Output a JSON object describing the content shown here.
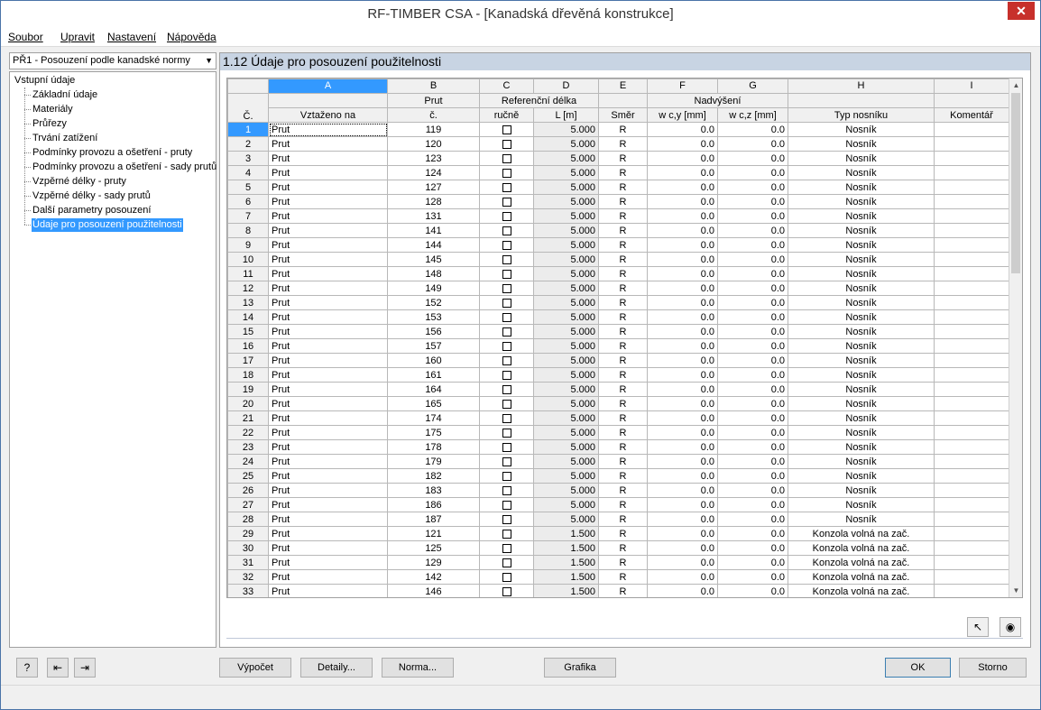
{
  "window": {
    "title": "RF-TIMBER CSA - [Kanadská dřevěná konstrukce]",
    "close_glyph": "✕"
  },
  "menu": [
    "Soubor",
    "Upravit",
    "Nastavení",
    "Nápověda"
  ],
  "case_selector": "PŘ1 - Posouzení podle kanadské normy",
  "tree": {
    "root": "Vstupní údaje",
    "items": [
      "Základní údaje",
      "Materiály",
      "Průřezy",
      "Trvání zatížení",
      "Podmínky provozu a ošetření - pruty",
      "Podmínky provozu a ošetření - sady prutů",
      "Vzpěrné délky - pruty",
      "Vzpěrné délky - sady prutů",
      "Další parametry posouzení",
      "Údaje pro posouzení použitelnosti"
    ],
    "selected_index": 9
  },
  "panel": {
    "title": "1.12  Údaje pro posouzení použitelnosti"
  },
  "grid": {
    "col_letters": [
      "A",
      "B",
      "C",
      "D",
      "E",
      "F",
      "G",
      "H",
      "I"
    ],
    "header_row1": {
      "b": "Prut",
      "cd": "Referenční délka",
      "fg": "Nadvýšení"
    },
    "header_row2": {
      "no": "Č.",
      "a": "Vztaženo na",
      "b": "č.",
      "c": "ručně",
      "d": "L [m]",
      "e": "Směr",
      "f": "w c,y [mm]",
      "g": "w c,z [mm]",
      "h": "Typ nosníku",
      "i": "Komentář"
    },
    "rows": [
      {
        "no": "1",
        "ref": "Prut",
        "member": "119",
        "L": "5.000",
        "dir": "R",
        "wy": "0.0",
        "wz": "0.0",
        "type": "Nosník"
      },
      {
        "no": "2",
        "ref": "Prut",
        "member": "120",
        "L": "5.000",
        "dir": "R",
        "wy": "0.0",
        "wz": "0.0",
        "type": "Nosník"
      },
      {
        "no": "3",
        "ref": "Prut",
        "member": "123",
        "L": "5.000",
        "dir": "R",
        "wy": "0.0",
        "wz": "0.0",
        "type": "Nosník"
      },
      {
        "no": "4",
        "ref": "Prut",
        "member": "124",
        "L": "5.000",
        "dir": "R",
        "wy": "0.0",
        "wz": "0.0",
        "type": "Nosník"
      },
      {
        "no": "5",
        "ref": "Prut",
        "member": "127",
        "L": "5.000",
        "dir": "R",
        "wy": "0.0",
        "wz": "0.0",
        "type": "Nosník"
      },
      {
        "no": "6",
        "ref": "Prut",
        "member": "128",
        "L": "5.000",
        "dir": "R",
        "wy": "0.0",
        "wz": "0.0",
        "type": "Nosník"
      },
      {
        "no": "7",
        "ref": "Prut",
        "member": "131",
        "L": "5.000",
        "dir": "R",
        "wy": "0.0",
        "wz": "0.0",
        "type": "Nosník"
      },
      {
        "no": "8",
        "ref": "Prut",
        "member": "141",
        "L": "5.000",
        "dir": "R",
        "wy": "0.0",
        "wz": "0.0",
        "type": "Nosník"
      },
      {
        "no": "9",
        "ref": "Prut",
        "member": "144",
        "L": "5.000",
        "dir": "R",
        "wy": "0.0",
        "wz": "0.0",
        "type": "Nosník"
      },
      {
        "no": "10",
        "ref": "Prut",
        "member": "145",
        "L": "5.000",
        "dir": "R",
        "wy": "0.0",
        "wz": "0.0",
        "type": "Nosník"
      },
      {
        "no": "11",
        "ref": "Prut",
        "member": "148",
        "L": "5.000",
        "dir": "R",
        "wy": "0.0",
        "wz": "0.0",
        "type": "Nosník"
      },
      {
        "no": "12",
        "ref": "Prut",
        "member": "149",
        "L": "5.000",
        "dir": "R",
        "wy": "0.0",
        "wz": "0.0",
        "type": "Nosník"
      },
      {
        "no": "13",
        "ref": "Prut",
        "member": "152",
        "L": "5.000",
        "dir": "R",
        "wy": "0.0",
        "wz": "0.0",
        "type": "Nosník"
      },
      {
        "no": "14",
        "ref": "Prut",
        "member": "153",
        "L": "5.000",
        "dir": "R",
        "wy": "0.0",
        "wz": "0.0",
        "type": "Nosník"
      },
      {
        "no": "15",
        "ref": "Prut",
        "member": "156",
        "L": "5.000",
        "dir": "R",
        "wy": "0.0",
        "wz": "0.0",
        "type": "Nosník"
      },
      {
        "no": "16",
        "ref": "Prut",
        "member": "157",
        "L": "5.000",
        "dir": "R",
        "wy": "0.0",
        "wz": "0.0",
        "type": "Nosník"
      },
      {
        "no": "17",
        "ref": "Prut",
        "member": "160",
        "L": "5.000",
        "dir": "R",
        "wy": "0.0",
        "wz": "0.0",
        "type": "Nosník"
      },
      {
        "no": "18",
        "ref": "Prut",
        "member": "161",
        "L": "5.000",
        "dir": "R",
        "wy": "0.0",
        "wz": "0.0",
        "type": "Nosník"
      },
      {
        "no": "19",
        "ref": "Prut",
        "member": "164",
        "L": "5.000",
        "dir": "R",
        "wy": "0.0",
        "wz": "0.0",
        "type": "Nosník"
      },
      {
        "no": "20",
        "ref": "Prut",
        "member": "165",
        "L": "5.000",
        "dir": "R",
        "wy": "0.0",
        "wz": "0.0",
        "type": "Nosník"
      },
      {
        "no": "21",
        "ref": "Prut",
        "member": "174",
        "L": "5.000",
        "dir": "R",
        "wy": "0.0",
        "wz": "0.0",
        "type": "Nosník"
      },
      {
        "no": "22",
        "ref": "Prut",
        "member": "175",
        "L": "5.000",
        "dir": "R",
        "wy": "0.0",
        "wz": "0.0",
        "type": "Nosník"
      },
      {
        "no": "23",
        "ref": "Prut",
        "member": "178",
        "L": "5.000",
        "dir": "R",
        "wy": "0.0",
        "wz": "0.0",
        "type": "Nosník"
      },
      {
        "no": "24",
        "ref": "Prut",
        "member": "179",
        "L": "5.000",
        "dir": "R",
        "wy": "0.0",
        "wz": "0.0",
        "type": "Nosník"
      },
      {
        "no": "25",
        "ref": "Prut",
        "member": "182",
        "L": "5.000",
        "dir": "R",
        "wy": "0.0",
        "wz": "0.0",
        "type": "Nosník"
      },
      {
        "no": "26",
        "ref": "Prut",
        "member": "183",
        "L": "5.000",
        "dir": "R",
        "wy": "0.0",
        "wz": "0.0",
        "type": "Nosník"
      },
      {
        "no": "27",
        "ref": "Prut",
        "member": "186",
        "L": "5.000",
        "dir": "R",
        "wy": "0.0",
        "wz": "0.0",
        "type": "Nosník"
      },
      {
        "no": "28",
        "ref": "Prut",
        "member": "187",
        "L": "5.000",
        "dir": "R",
        "wy": "0.0",
        "wz": "0.0",
        "type": "Nosník"
      },
      {
        "no": "29",
        "ref": "Prut",
        "member": "121",
        "L": "1.500",
        "dir": "R",
        "wy": "0.0",
        "wz": "0.0",
        "type": "Konzola volná na zač."
      },
      {
        "no": "30",
        "ref": "Prut",
        "member": "125",
        "L": "1.500",
        "dir": "R",
        "wy": "0.0",
        "wz": "0.0",
        "type": "Konzola volná na zač."
      },
      {
        "no": "31",
        "ref": "Prut",
        "member": "129",
        "L": "1.500",
        "dir": "R",
        "wy": "0.0",
        "wz": "0.0",
        "type": "Konzola volná na zač."
      },
      {
        "no": "32",
        "ref": "Prut",
        "member": "142",
        "L": "1.500",
        "dir": "R",
        "wy": "0.0",
        "wz": "0.0",
        "type": "Konzola volná na zač."
      },
      {
        "no": "33",
        "ref": "Prut",
        "member": "146",
        "L": "1.500",
        "dir": "R",
        "wy": "0.0",
        "wz": "0.0",
        "type": "Konzola volná na zač."
      }
    ]
  },
  "buttons": {
    "calc": "Výpočet",
    "details": "Detaily...",
    "norm": "Norma...",
    "graphics": "Grafika",
    "ok": "OK",
    "cancel": "Storno"
  },
  "icons": {
    "help": "?",
    "export": "⇤",
    "import": "⇥",
    "pick": "↖",
    "view": "◉",
    "scroll_up": "▲",
    "scroll_down": "▼",
    "dropdown": "▼"
  }
}
